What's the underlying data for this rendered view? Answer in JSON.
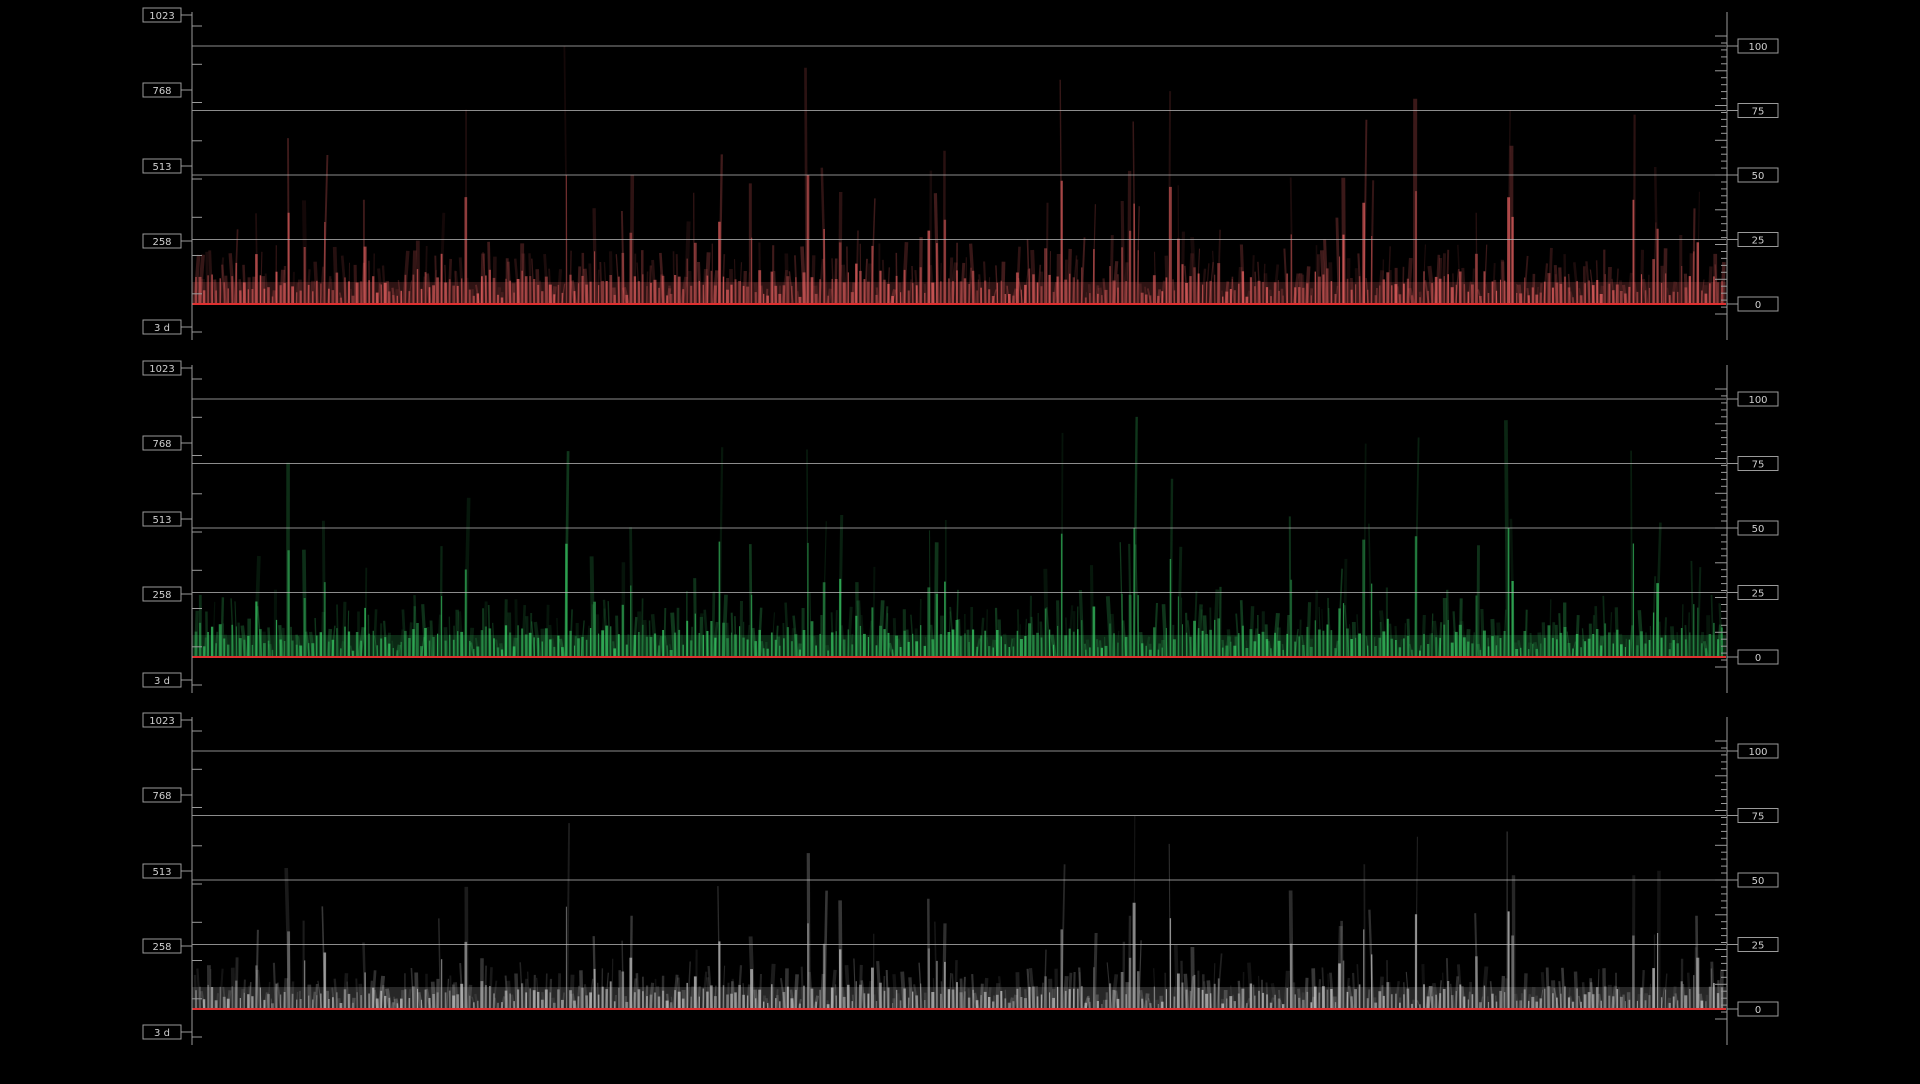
{
  "app": {
    "view": "RGB Parade waveform scope"
  },
  "scale": {
    "left_labels": [
      "1023",
      "768",
      "513",
      "258",
      "3 d"
    ],
    "right_labels": [
      "100",
      "75",
      "50",
      "25",
      "0"
    ]
  },
  "panels": [
    {
      "id": "red",
      "trace_color": "#ff6b6b",
      "glow_color": "#ffb0b0"
    },
    {
      "id": "green",
      "trace_color": "#3fe070",
      "glow_color": "#b0ffc8"
    },
    {
      "id": "blue",
      "trace_color": "#d8d8d8",
      "glow_color": "#ffffff"
    }
  ],
  "colors": {
    "background": "#000000",
    "graticule": "#bbbbbb",
    "baseline": "#e03030",
    "label_box": "#9a9a9a"
  }
}
